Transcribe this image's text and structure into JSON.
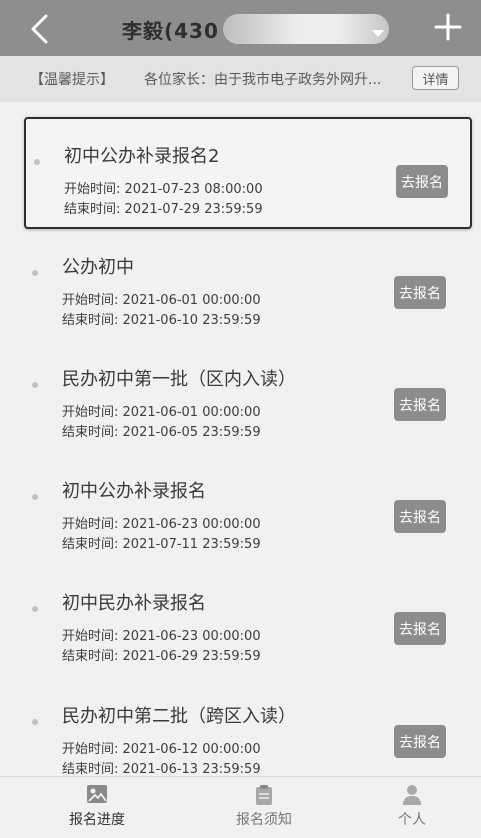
{
  "header": {
    "title": "李毅(430",
    "back_icon": "chevron-left-icon",
    "dropdown_icon": "caret-down-icon",
    "add_icon": "plus-icon"
  },
  "notice": {
    "tag": "【温馨提示】",
    "text": "各位家长：由于我市电子政务外网升...",
    "detail_label": "详情"
  },
  "cards": [
    {
      "title": "初中公办补录报名2",
      "start_label": "开始时间:",
      "start": "2021-07-23 08:00:00",
      "end_label": "结束时间:",
      "end": "2021-07-29 23:59:59",
      "button": "去报名"
    },
    {
      "title": "公办初中",
      "start_label": "开始时间:",
      "start": "2021-06-01 00:00:00",
      "end_label": "结束时间:",
      "end": "2021-06-10 23:59:59",
      "button": "去报名"
    },
    {
      "title": "民办初中第一批（区内入读）",
      "start_label": "开始时间:",
      "start": "2021-06-01 00:00:00",
      "end_label": "结束时间:",
      "end": "2021-06-05 23:59:59",
      "button": "去报名"
    },
    {
      "title": "初中公办补录报名",
      "start_label": "开始时间:",
      "start": "2021-06-23 00:00:00",
      "end_label": "结束时间:",
      "end": "2021-07-11 23:59:59",
      "button": "去报名"
    },
    {
      "title": "初中民办补录报名",
      "start_label": "开始时间:",
      "start": "2021-06-23 00:00:00",
      "end_label": "结束时间:",
      "end": "2021-06-29 23:59:59",
      "button": "去报名"
    },
    {
      "title": "民办初中第二批（跨区入读）",
      "start_label": "开始时间:",
      "start": "2021-06-12 00:00:00",
      "end_label": "结束时间:",
      "end": "2021-06-13 23:59:59",
      "button": "去报名"
    }
  ],
  "nav": {
    "progress": "报名进度",
    "notice": "报名须知",
    "personal": "个人"
  }
}
